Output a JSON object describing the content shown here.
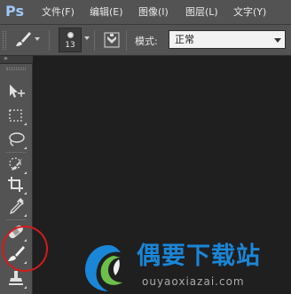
{
  "app": {
    "logo": "Ps"
  },
  "menu": [
    {
      "label": "文件(F)"
    },
    {
      "label": "编辑(E)"
    },
    {
      "label": "图像(I)"
    },
    {
      "label": "图层(L)"
    },
    {
      "label": "文字(Y)"
    }
  ],
  "options": {
    "tool_preset_icon": "brush-icon",
    "brush_size": "13",
    "mode_label": "模式:",
    "mode_value": "正常"
  },
  "toolbox": {
    "collapse_label": "»",
    "tools": [
      {
        "name": "move-tool",
        "icon": "move-icon"
      },
      {
        "name": "marquee-tool",
        "icon": "rect-marquee-icon"
      },
      {
        "name": "lasso-tool",
        "icon": "lasso-icon"
      },
      {
        "name": "quick-select-tool",
        "icon": "quick-select-icon"
      },
      {
        "name": "crop-tool",
        "icon": "crop-icon"
      },
      {
        "name": "eyedropper-tool",
        "icon": "eyedropper-icon"
      },
      {
        "name": "healing-brush-tool",
        "icon": "bandage-icon"
      },
      {
        "name": "brush-tool",
        "icon": "brush-icon",
        "active": true
      },
      {
        "name": "clone-stamp-tool",
        "icon": "stamp-icon"
      }
    ]
  },
  "colors": {
    "highlight": "#d31b1b",
    "watermark_blue": "#1a86d8",
    "ps_blue": "#9ec8f5"
  },
  "watermark": {
    "title": "偶要下载站",
    "url": "ouyaoxiazai.com"
  }
}
